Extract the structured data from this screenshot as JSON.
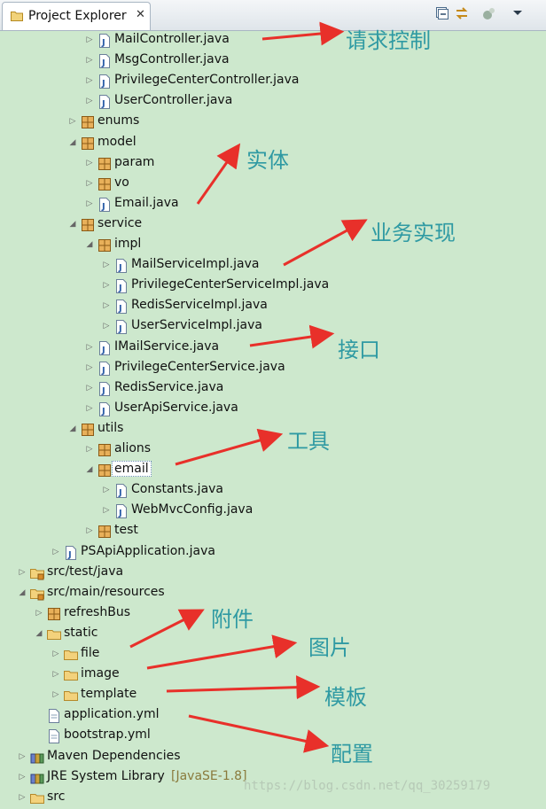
{
  "tab": {
    "label": "Project Explorer",
    "close": "✕"
  },
  "toolbar": [
    "collapse-all-icon",
    "link-editor-icon",
    "focus-icon",
    "view-menu-icon"
  ],
  "tree": [
    {
      "label": "MailController.java",
      "indent": 5,
      "icon": "java"
    },
    {
      "label": "MsgController.java",
      "indent": 5,
      "icon": "java"
    },
    {
      "label": "PrivilegeCenterController.java",
      "indent": 5,
      "icon": "java"
    },
    {
      "label": "UserController.java",
      "indent": 5,
      "icon": "java"
    },
    {
      "label": "enums",
      "indent": 4,
      "icon": "package"
    },
    {
      "label": "model",
      "indent": 4,
      "icon": "package",
      "expanded": true
    },
    {
      "label": "param",
      "indent": 5,
      "icon": "package"
    },
    {
      "label": "vo",
      "indent": 5,
      "icon": "package"
    },
    {
      "label": "Email.java",
      "indent": 5,
      "icon": "java"
    },
    {
      "label": "service",
      "indent": 4,
      "icon": "package",
      "expanded": true
    },
    {
      "label": "impl",
      "indent": 5,
      "icon": "package",
      "expanded": true
    },
    {
      "label": "MailServiceImpl.java",
      "indent": 6,
      "icon": "java"
    },
    {
      "label": "PrivilegeCenterServiceImpl.java",
      "indent": 6,
      "icon": "java"
    },
    {
      "label": "RedisServiceImpl.java",
      "indent": 6,
      "icon": "java"
    },
    {
      "label": "UserServiceImpl.java",
      "indent": 6,
      "icon": "java"
    },
    {
      "label": "IMailService.java",
      "indent": 5,
      "icon": "java"
    },
    {
      "label": "PrivilegeCenterService.java",
      "indent": 5,
      "icon": "java"
    },
    {
      "label": "RedisService.java",
      "indent": 5,
      "icon": "java"
    },
    {
      "label": "UserApiService.java",
      "indent": 5,
      "icon": "java"
    },
    {
      "label": "utils",
      "indent": 4,
      "icon": "package",
      "expanded": true
    },
    {
      "label": "alions",
      "indent": 5,
      "icon": "package"
    },
    {
      "label": "email",
      "indent": 5,
      "icon": "package",
      "expanded": true,
      "selected": true
    },
    {
      "label": "Constants.java",
      "indent": 6,
      "icon": "java"
    },
    {
      "label": "WebMvcConfig.java",
      "indent": 6,
      "icon": "java"
    },
    {
      "label": "test",
      "indent": 5,
      "icon": "package"
    },
    {
      "label": "PSApiApplication.java",
      "indent": 3,
      "icon": "java"
    },
    {
      "label": "src/test/java",
      "indent": 1,
      "icon": "srcfolder"
    },
    {
      "label": "src/main/resources",
      "indent": 1,
      "icon": "srcfolder",
      "expanded": true
    },
    {
      "label": "refreshBus",
      "indent": 2,
      "icon": "package"
    },
    {
      "label": "static",
      "indent": 2,
      "icon": "folder",
      "expanded": true
    },
    {
      "label": "file",
      "indent": 3,
      "icon": "folder"
    },
    {
      "label": "image",
      "indent": 3,
      "icon": "folder"
    },
    {
      "label": "template",
      "indent": 3,
      "icon": "folder"
    },
    {
      "label": "application.yml",
      "indent": 2,
      "icon": "file",
      "leaf": true
    },
    {
      "label": "bootstrap.yml",
      "indent": 2,
      "icon": "file",
      "leaf": true
    },
    {
      "label": "Maven Dependencies",
      "indent": 1,
      "icon": "library"
    },
    {
      "label": "JRE System Library",
      "indent": 1,
      "icon": "library",
      "sub": "[JavaSE-1.8]"
    },
    {
      "label": "src",
      "indent": 1,
      "icon": "folder"
    }
  ],
  "annotations": [
    {
      "text": "请求控制"
    },
    {
      "text": "实体"
    },
    {
      "text": "业务实现"
    },
    {
      "text": "接口"
    },
    {
      "text": "工具"
    },
    {
      "text": "附件"
    },
    {
      "text": "图片"
    },
    {
      "text": "模板"
    },
    {
      "text": "配置"
    }
  ],
  "watermark": "https://blog.csdn.net/qq_30259179",
  "colors": {
    "background": "#cde8cd",
    "annotation": "#2f9aa3",
    "arrow": "#e8302a"
  }
}
